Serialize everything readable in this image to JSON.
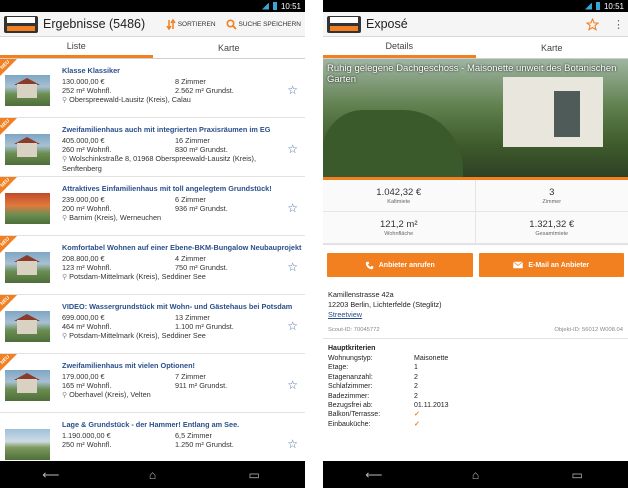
{
  "left": {
    "status_time": "10:51",
    "logo_text": "IMMOBILIEN SCOUT 24",
    "title": "Ergebnisse (5486)",
    "actions": [
      {
        "label": "SORTIEREN",
        "icon": "sort-icon"
      },
      {
        "label": "SUCHE SPEICHERN",
        "icon": "search-save-icon"
      }
    ],
    "tabs": [
      "Liste",
      "Karte"
    ],
    "neu_label": "NEU",
    "listings": [
      {
        "title": "Klasse Klassiker",
        "price": "130.000,00 €",
        "rooms": "8 Zimmer",
        "area": "252 m² Wohnfl.",
        "plot": "2.562 m² Grundst.",
        "location": "Oberspreewald-Lausitz (Kreis), Calau"
      },
      {
        "title": "Zweifamilienhaus auch mit integrierten Praxisräumen im EG",
        "price": "405.000,00 €",
        "rooms": "16 Zimmer",
        "area": "260 m² Wohnfl.",
        "plot": "830 m² Grundst.",
        "location": "Wolschinkstraße 8, 01968 Oberspreewald-Lausitz (Kreis), Senftenberg"
      },
      {
        "title": "Attraktives Einfamilienhaus mit toll angelegtem Grundstück!",
        "price": "239.000,00 €",
        "rooms": "6 Zimmer",
        "area": "200 m² Wohnfl.",
        "plot": "936 m² Grundst.",
        "location": "Barnim (Kreis), Werneuchen"
      },
      {
        "title": "Komfortabel Wohnen auf einer Ebene-BKM-Bungalow Neubauprojekt",
        "price": "208.800,00 €",
        "rooms": "4 Zimmer",
        "area": "123 m² Wohnfl.",
        "plot": "750 m² Grundst.",
        "location": "Potsdam-Mittelmark (Kreis), Seddiner See"
      },
      {
        "title": "VIDEO: Wassergrundstück mit Wohn- und Gästehaus bei Potsdam",
        "price": "699.000,00 €",
        "rooms": "13 Zimmer",
        "area": "464 m² Wohnfl.",
        "plot": "1.100 m² Grundst.",
        "location": "Potsdam-Mittelmark (Kreis), Seddiner See"
      },
      {
        "title": "Zweifamilienhaus mit vielen Optionen!",
        "price": "179.000,00 €",
        "rooms": "7 Zimmer",
        "area": "165 m² Wohnfl.",
        "plot": "911 m² Grundst.",
        "location": "Oberhavel (Kreis), Velten"
      },
      {
        "title": "Lage & Grundstück - der Hammer! Entlang am See.",
        "price": "1.190.000,00 €",
        "rooms": "6,5 Zimmer",
        "area": "250 m² Wohnfl.",
        "plot": "1.250 m² Grundst.",
        "location": ""
      }
    ]
  },
  "right": {
    "status_time": "10:51",
    "logo_text": "IMMOBILIEN SCOUT 24",
    "title": "Exposé",
    "tabs": [
      "Details",
      "Karte"
    ],
    "hero_title": "Ruhig gelegene Dachgeschoss - Maisonette unweit des Botanischen Garten",
    "facts": [
      {
        "value": "1.042,32 €",
        "label": "Kaltmiete"
      },
      {
        "value": "3",
        "label": "Zimmer"
      },
      {
        "value": "121,2 m²",
        "label": "Wohnfläche"
      },
      {
        "value": "1.321,32 €",
        "label": "Gesamtmiete"
      }
    ],
    "call_button": "Anbieter anrufen",
    "email_button": "E-Mail an Anbieter",
    "street": "Kamillenstrasse 42a",
    "city": "12203 Berlin, Lichterfelde (Steglitz)",
    "streetview": "Streetview",
    "scout_id": "Scout-ID: 70045772",
    "objekt_id": "Objekt-ID: 56012 W008.04",
    "criteria_title": "Hauptkriterien",
    "criteria": [
      {
        "k": "Wohnungstyp:",
        "v": "Maisonette"
      },
      {
        "k": "Etage:",
        "v": "1"
      },
      {
        "k": "Etagenanzahl:",
        "v": "2"
      },
      {
        "k": "Schlafzimmer:",
        "v": "2"
      },
      {
        "k": "Badezimmer:",
        "v": "2"
      },
      {
        "k": "Bezugsfrei ab:",
        "v": "01.11.2013"
      },
      {
        "k": "Balkon/Terrasse:",
        "v": "✓"
      },
      {
        "k": "Einbauküche:",
        "v": "✓"
      }
    ]
  },
  "colors": {
    "accent": "#f27f20",
    "link": "#2a4f8a"
  }
}
